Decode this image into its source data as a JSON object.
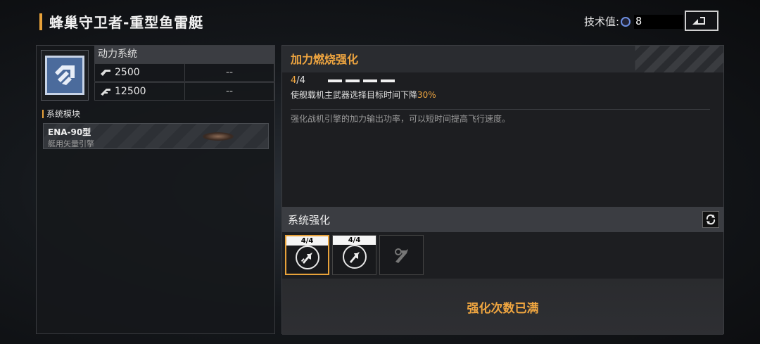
{
  "header": {
    "title": "蜂巢守卫者-重型鱼雷艇",
    "tech_label": "技术值:",
    "tech_value": "8"
  },
  "left_panel": {
    "system_name": "动力系统",
    "stats": [
      {
        "value": "2500",
        "extra": "--"
      },
      {
        "value": "12500",
        "extra": "--"
      }
    ],
    "module_section_label": "系统模块",
    "module": {
      "name": "ENA-90型",
      "subtitle": "艇用矢量引擎"
    }
  },
  "skill": {
    "name": "加力燃烧强化",
    "level_current": "4",
    "level_sep": "/4",
    "pips_filled": 4,
    "effect_prefix": "使舰载机主武器选择目标时间下降",
    "effect_value": "30%",
    "description": "强化战机引擎的加力输出功率，可以短时间提高飞行速度。"
  },
  "enhance": {
    "title": "系统强化",
    "slots": [
      {
        "level": "4/4",
        "state": "active"
      },
      {
        "level": "4/4",
        "state": "normal"
      },
      {
        "level": "",
        "state": "locked"
      }
    ],
    "status": "强化次数已满"
  },
  "colors": {
    "accent": "#f0a640",
    "panel": "#1d1e21"
  }
}
